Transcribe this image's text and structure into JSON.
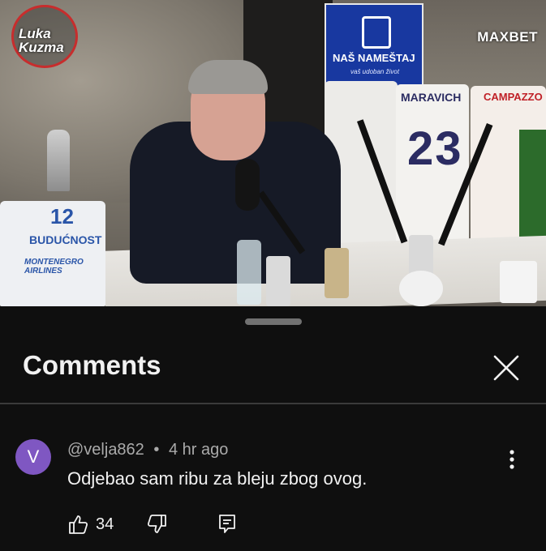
{
  "video": {
    "channel_logo_text": "Luka Kuzma",
    "sponsor_logo_text": "MAXBET",
    "banner_title": "NAŠ NAMEŠTAJ",
    "banner_subtitle": "vaš udoban život",
    "jersey_left_number": "12",
    "jersey_left_team": "BUDUĆNOST",
    "jersey_left_sponsor": "MONTENEGRO AIRLINES",
    "jersey_mid_number": "23",
    "jersey_mid_name": "MARAVICH",
    "jersey_right_name": "CAMPAZZO"
  },
  "sheet": {
    "title": "Comments"
  },
  "comment": {
    "avatar_letter": "V",
    "avatar_color": "#7f57c2",
    "author": "@velja862",
    "separator": "•",
    "time": "4 hr ago",
    "text": "Odjebao sam ribu za bleju zbog ovog.",
    "likes": "34"
  },
  "icons": {
    "close": "close-icon",
    "more": "more-vertical-icon",
    "like": "thumbs-up-icon",
    "dislike": "thumbs-down-icon",
    "reply": "reply-icon"
  }
}
